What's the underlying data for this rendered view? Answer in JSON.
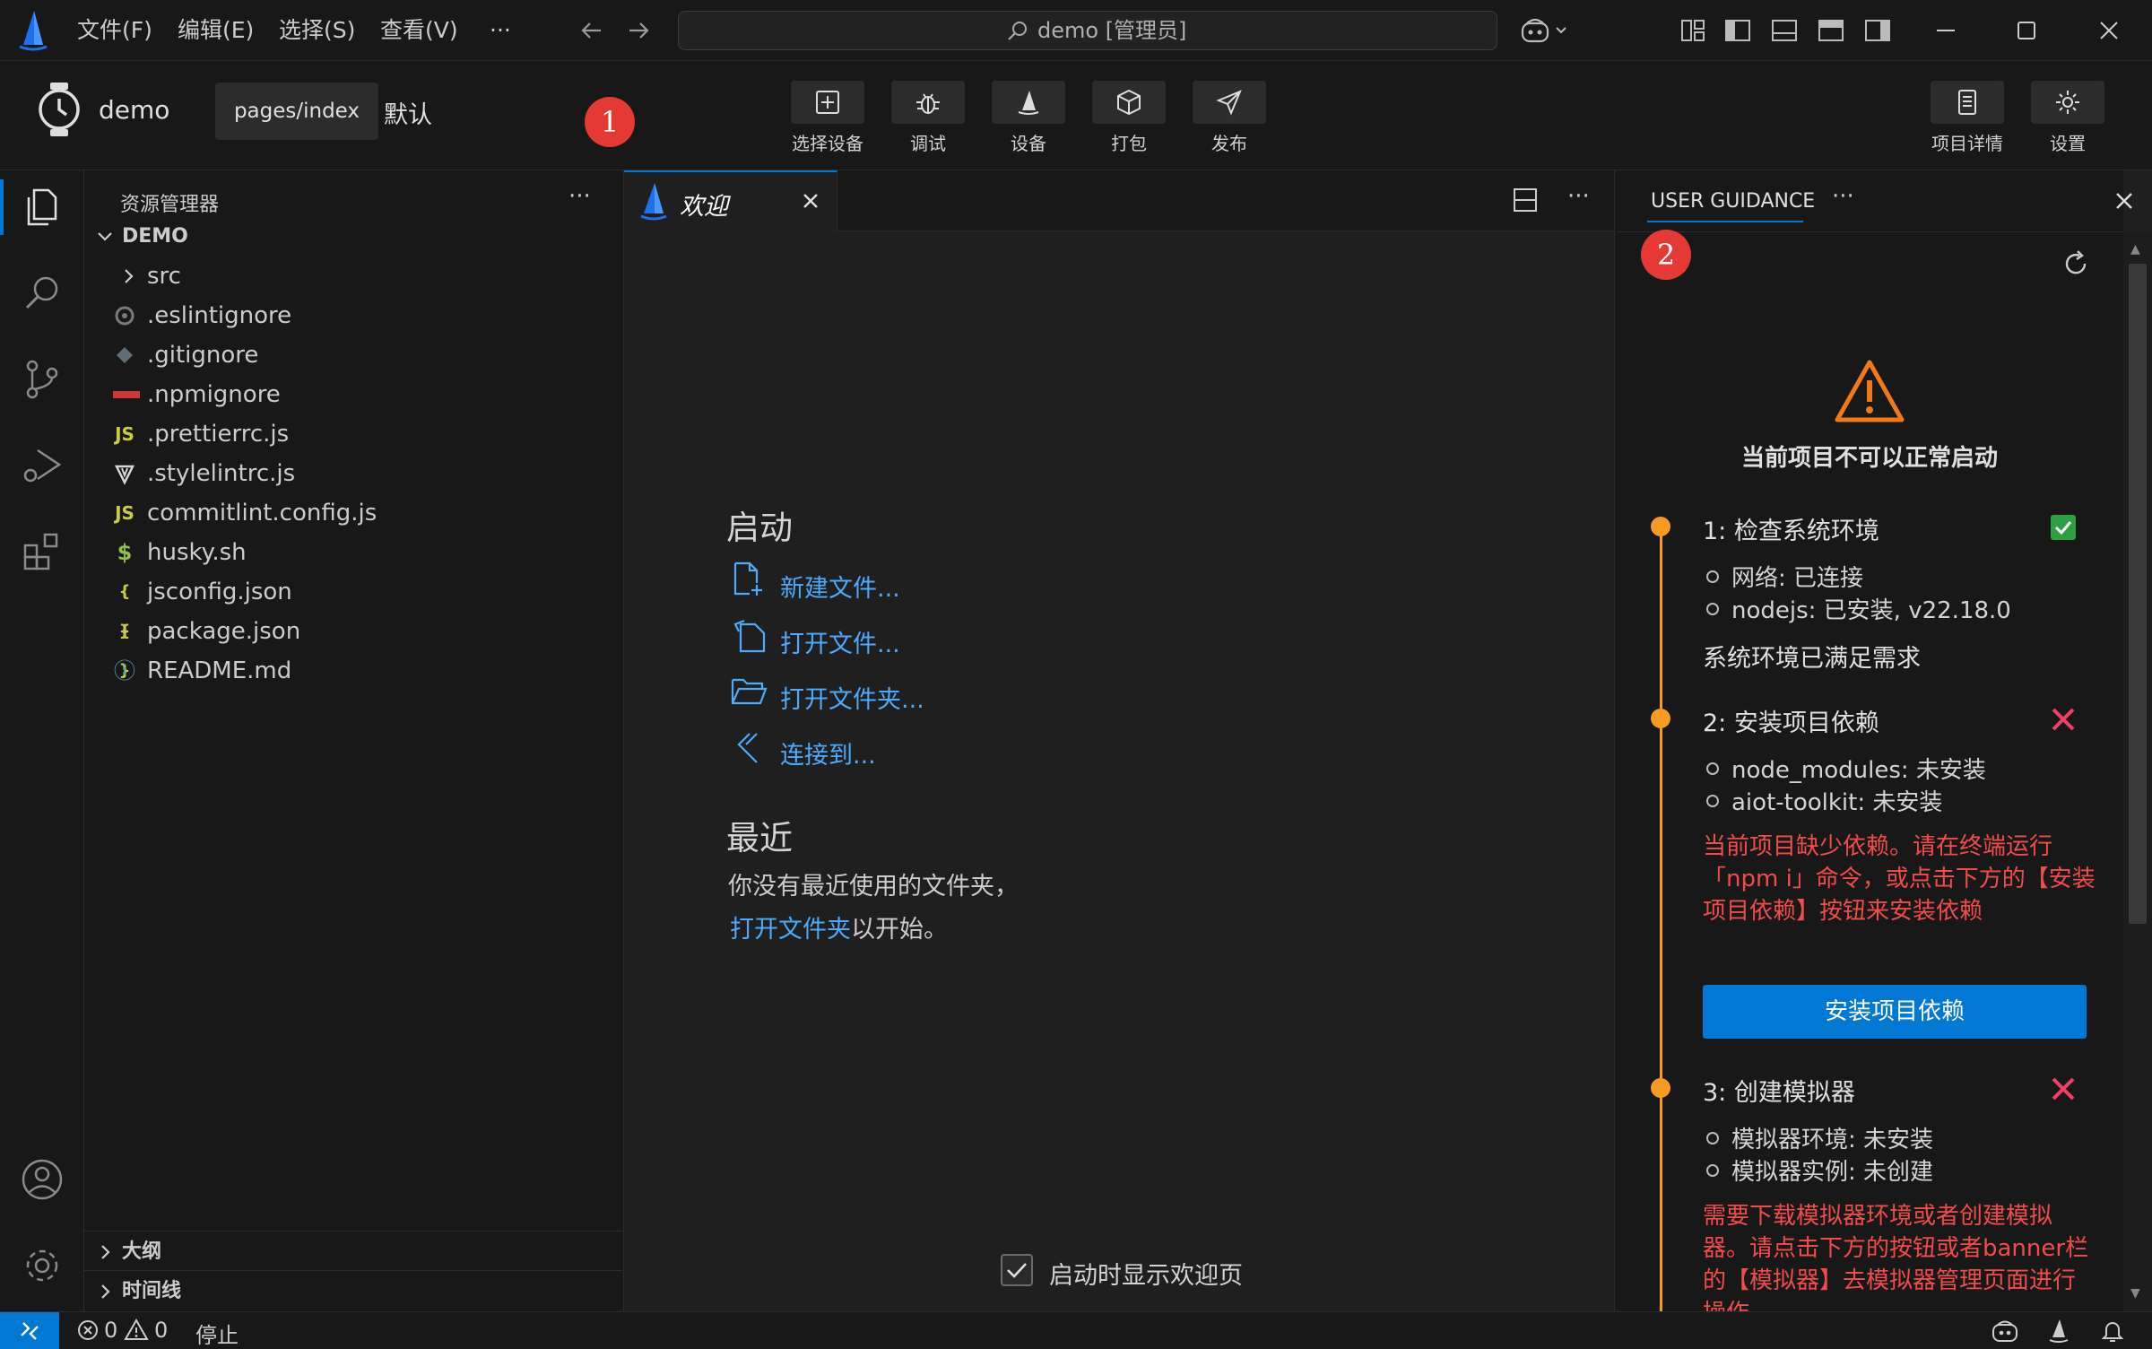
{
  "titlebar": {
    "menus": [
      "文件(F)",
      "编辑(E)",
      "选择(S)",
      "查看(V)",
      "···"
    ],
    "search_text": "demo [管理员]"
  },
  "toolbar": {
    "project_name": "demo",
    "page_path": "pages/index",
    "page_mode": "默认",
    "tools": [
      "选择设备",
      "调试",
      "设备",
      "打包",
      "发布"
    ],
    "right_tools": [
      "项目详情",
      "设置"
    ]
  },
  "explorer": {
    "title": "资源管理器",
    "root": "DEMO",
    "items": [
      {
        "name": "src",
        "icon": "chevron-right-icon"
      },
      {
        "name": ".eslintignore",
        "icon": "eslint-icon"
      },
      {
        "name": ".gitignore",
        "icon": "git-icon"
      },
      {
        "name": ".npmignore",
        "icon": "npm-icon"
      },
      {
        "name": ".prettierrc.js",
        "icon": "js-icon",
        "glyph": "JS"
      },
      {
        "name": ".stylelintrc.js",
        "icon": "stylelint-icon"
      },
      {
        "name": "commitlint.config.js",
        "icon": "js-icon",
        "glyph": "JS"
      },
      {
        "name": "husky.sh",
        "icon": "shell-icon",
        "glyph": "$"
      },
      {
        "name": "jsconfig.json",
        "icon": "json-icon",
        "glyph": "{ }"
      },
      {
        "name": "package.json",
        "icon": "json-icon",
        "glyph": "{ }"
      },
      {
        "name": "README.md",
        "icon": "info-icon",
        "glyph": "ⓘ"
      }
    ],
    "outline": "大纲",
    "timeline": "时间线"
  },
  "editor": {
    "tab_label": "欢迎",
    "start_heading": "启动",
    "actions": [
      "新建文件...",
      "打开文件...",
      "打开文件夹...",
      "连接到..."
    ],
    "recent_heading": "最近",
    "recent_empty": "你没有最近使用的文件夹，",
    "recent_link": "打开文件夹",
    "recent_suffix": "以开始。",
    "show_on_startup": "启动时显示欢迎页"
  },
  "guidance": {
    "title": "USER GUIDANCE",
    "status": "当前项目不可以正常启动",
    "steps": [
      {
        "title": "1: 检查系统环境",
        "ok": true,
        "bullets": [
          "网络: 已连接",
          "nodejs: 已安装, v22.18.0"
        ],
        "summary": "系统环境已满足需求"
      },
      {
        "title": "2: 安装项目依赖",
        "ok": false,
        "bullets": [
          "node_modules: 未安装",
          "aiot-toolkit: 未安装"
        ],
        "warning": "当前项目缺少依赖。请在终端运行「npm i」命令，或点击下方的【安装项目依赖】按钮来安装依赖",
        "button": "安装项目依赖"
      },
      {
        "title": "3: 创建模拟器",
        "ok": false,
        "bullets": [
          "模拟器环境: 未安装",
          "模拟器实例: 未创建"
        ],
        "warning": "需要下载模拟器环境或者创建模拟器。请点击下方的按钮或者banner栏的【模拟器】去模拟器管理页面进行操作"
      }
    ]
  },
  "statusbar": {
    "errors": "0",
    "warnings": "0",
    "stop": "停止"
  },
  "badges": [
    "1",
    "2"
  ],
  "colors": {
    "accent": "#0078d4",
    "link": "#4daafc",
    "ok": "#2ea043",
    "error": "#f14c4c",
    "step_dot": "#f59a23",
    "badge": "#e53935"
  }
}
